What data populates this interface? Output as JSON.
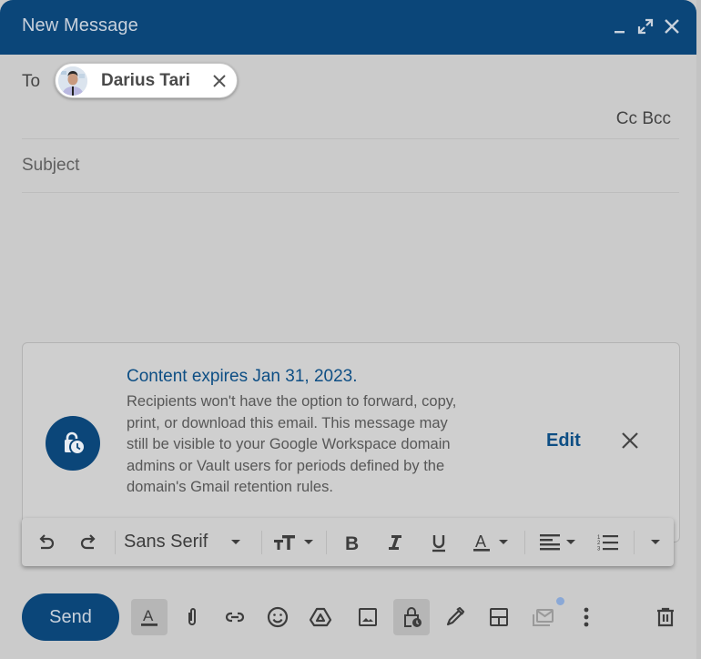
{
  "window": {
    "title": "New Message",
    "controls": {
      "minimize": "minimize-icon",
      "maximize": "fullscreen-icon",
      "close": "close-icon"
    }
  },
  "recipients": {
    "to_label": "To",
    "chips": [
      {
        "name": "Darius Tari",
        "avatar": "avatar-photo",
        "remove_icon": "close-icon"
      }
    ],
    "cc_label": "Cc",
    "bcc_label": "Bcc"
  },
  "subject": {
    "placeholder": "Subject",
    "value": ""
  },
  "body": {
    "value": ""
  },
  "confidential_notice": {
    "icon": "lock-clock-icon",
    "title": "Content expires Jan 31, 2023.",
    "text": "Recipients won't have the option to forward, copy, print, or download this email. This message may still be visible to your Google Workspace domain admins or Vault users for periods defined by the domain's Gmail retention rules.",
    "edit_label": "Edit",
    "close_icon": "close-icon"
  },
  "formatting_toolbar": {
    "undo": "undo-icon",
    "redo": "redo-icon",
    "font": "Sans Serif",
    "size": "text-size-icon",
    "bold": "bold-icon",
    "italic": "italic-icon",
    "underline": "underline-icon",
    "text_color": "text-color-icon",
    "align": "align-left-icon",
    "numbered_list": "numbered-list-icon",
    "more": "more-formatting-icon"
  },
  "bottom_toolbar": {
    "send_label": "Send",
    "items": [
      "formatting-options-icon",
      "attach-icon",
      "link-icon",
      "emoji-icon",
      "drive-icon",
      "photo-icon",
      "confidential-mode-icon",
      "signature-icon",
      "layouts-icon",
      "schedule-email-icon",
      "more-options-icon",
      "delete-icon"
    ]
  },
  "colors": {
    "brand": "#0b4679",
    "link": "#0d4e84",
    "background": "#cbcbcb"
  }
}
